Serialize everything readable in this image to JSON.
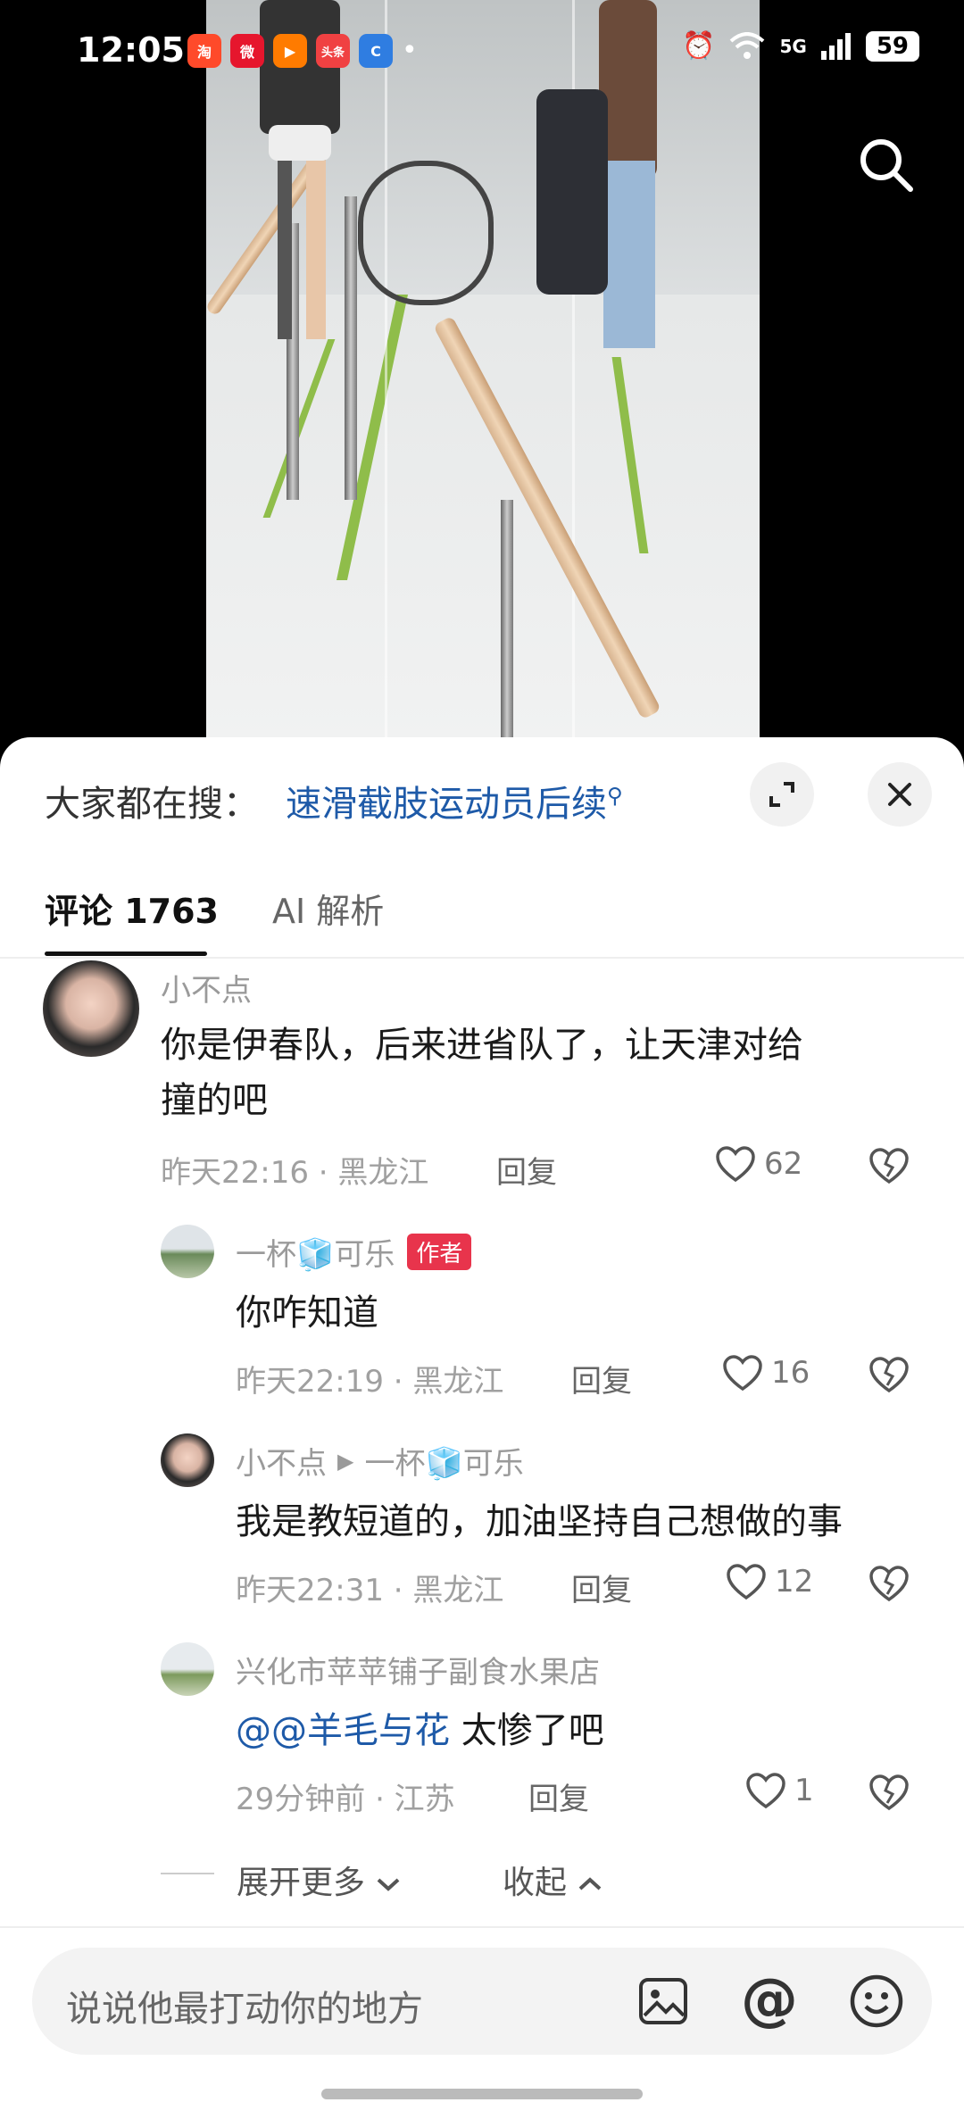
{
  "status_bar": {
    "time": "12:05",
    "apps": [
      {
        "icon": "taobao-icon",
        "label": "淘",
        "color": "#ff4a2a"
      },
      {
        "icon": "weibo-icon",
        "label": "微",
        "color": "#e6162d"
      },
      {
        "icon": "video-app-icon",
        "label": "▶",
        "color": "#ff7b00"
      },
      {
        "icon": "toutiao-icon",
        "label": "头条",
        "color": "#f04142"
      },
      {
        "icon": "app-c-icon",
        "label": "C",
        "color": "#2f7de1"
      }
    ],
    "network": "5G",
    "battery": "59"
  },
  "sheet": {
    "hot_search_label": "大家都在搜：",
    "hot_search_link": "速滑截肢运动员后续",
    "tabs": [
      {
        "label": "评论 1763"
      },
      {
        "label": "AI 解析"
      }
    ]
  },
  "comments": [
    {
      "username": "小不点",
      "text_line1": "你是伊春队，后来进省队了，让天津对给",
      "text_line2": "撞的吧",
      "meta": "昨天22:16 · 黑龙江",
      "reply_label": "回复",
      "likes": "62"
    },
    {
      "username": "一杯🧊可乐",
      "badge": "作者",
      "text": "你咋知道",
      "meta": "昨天22:19 · 黑龙江",
      "reply_label": "回复",
      "likes": "16"
    },
    {
      "username": "小不点",
      "reply_to": "一杯🧊可乐",
      "text": "我是教短道的，加油坚持自己想做的事",
      "meta": "昨天22:31 · 黑龙江",
      "reply_label": "回复",
      "likes": "12"
    },
    {
      "username": "兴化市苹苹铺子副食水果店",
      "mention": "@@羊毛与花",
      "text": " 太惨了吧",
      "meta": "29分钟前 · 江苏",
      "reply_label": "回复",
      "likes": "1"
    }
  ],
  "thread_controls": {
    "expand_label": "展开更多",
    "collapse_label": "收起"
  },
  "input": {
    "placeholder": "说说他最打动你的地方"
  }
}
